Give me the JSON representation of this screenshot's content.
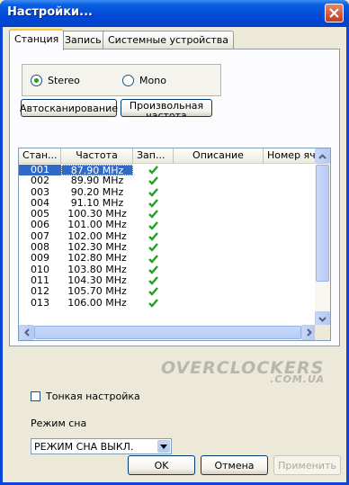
{
  "window": {
    "title": "Настройки...",
    "titlebar_color": "#0a5fe0"
  },
  "tabs": [
    {
      "label": "Станция",
      "active": true
    },
    {
      "label": "Запись",
      "active": false
    },
    {
      "label": "Системные устройства",
      "active": false
    }
  ],
  "audio_mode": {
    "options": [
      "Stereo",
      "Mono"
    ],
    "selected": "Stereo"
  },
  "buttons": {
    "autoscan": "Автосканирование",
    "custom_freq": "Произвольная частота",
    "ok": "OK",
    "cancel": "Отмена",
    "apply": "Применить"
  },
  "station_table": {
    "columns": [
      "Стан...",
      "Частота",
      "Зап...",
      "Описание",
      "Номер яч..."
    ],
    "rows": [
      {
        "num": "001",
        "freq": "87.90 MHz",
        "rec": true,
        "selected": true
      },
      {
        "num": "002",
        "freq": "89.90 MHz",
        "rec": true
      },
      {
        "num": "003",
        "freq": "90.20 MHz",
        "rec": true
      },
      {
        "num": "004",
        "freq": "91.10 MHz",
        "rec": true
      },
      {
        "num": "005",
        "freq": "100.30 MHz",
        "rec": true
      },
      {
        "num": "006",
        "freq": "101.00 MHz",
        "rec": true
      },
      {
        "num": "007",
        "freq": "102.00 MHz",
        "rec": true
      },
      {
        "num": "008",
        "freq": "102.30 MHz",
        "rec": true
      },
      {
        "num": "009",
        "freq": "102.80 MHz",
        "rec": true
      },
      {
        "num": "010",
        "freq": "103.80 MHz",
        "rec": true
      },
      {
        "num": "011",
        "freq": "104.30 MHz",
        "rec": true
      },
      {
        "num": "012",
        "freq": "105.70 MHz",
        "rec": true
      },
      {
        "num": "013",
        "freq": "106.00 MHz",
        "rec": true
      }
    ],
    "check_color": "#21a121",
    "selection_color": "#316ac5"
  },
  "watermark": {
    "text": "OVERCLOCKERS",
    "subtext": ".COM.UA"
  },
  "fine_tune": {
    "label": "Тонкая настройка",
    "checked": false
  },
  "sleep_mode": {
    "label": "Режим сна",
    "value": "РЕЖИМ СНА ВЫКЛ."
  }
}
